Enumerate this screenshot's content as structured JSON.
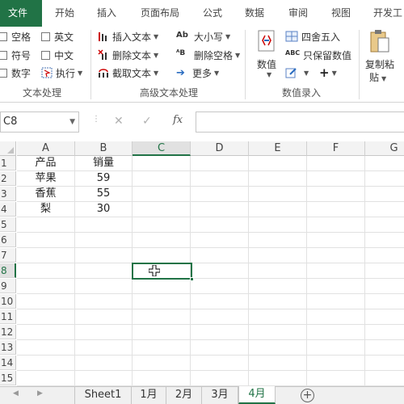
{
  "tabs": {
    "file": "文件",
    "items": [
      "开始",
      "插入",
      "页面布局",
      "公式",
      "数据",
      "审阅",
      "视图",
      "开发工具"
    ]
  },
  "ribbon": {
    "text_processing": {
      "items": [
        "空格",
        "英文",
        "符号",
        "中文",
        "数字",
        "执行"
      ],
      "label": "文本处理"
    },
    "advanced": {
      "insert_text": "插入文本",
      "delete_text": "删除文本",
      "extract_text": "截取文本",
      "case": "大小写",
      "delete_space": "删除空格",
      "more": "更多",
      "label": "高级文本处理"
    },
    "numeric": {
      "value": "数值",
      "round": "四舍五入",
      "keep_value": "只保留数值",
      "label": "数值录入"
    },
    "paste": {
      "label_line1": "复制粘",
      "label_line2": "贴"
    }
  },
  "formula_bar": {
    "name_box": "C8",
    "fx": "fx",
    "value": ""
  },
  "grid": {
    "columns": [
      "A",
      "B",
      "C",
      "D",
      "E",
      "F",
      "G"
    ],
    "rows": [
      "1",
      "2",
      "3",
      "4",
      "5",
      "6",
      "7",
      "8",
      "9",
      "10",
      "11",
      "12",
      "13",
      "14",
      "15"
    ],
    "cells": {
      "A1": "产品",
      "B1": "销量",
      "A2": "苹果",
      "B2": "59",
      "A3": "香蕉",
      "B3": "55",
      "A4": "梨",
      "B4": "30"
    },
    "selected": "C8"
  },
  "sheets": {
    "tabs": [
      "Sheet1",
      "1月",
      "2月",
      "3月",
      "4月"
    ],
    "active": "4月",
    "add": "+"
  },
  "colors": {
    "accent": "#217346"
  }
}
